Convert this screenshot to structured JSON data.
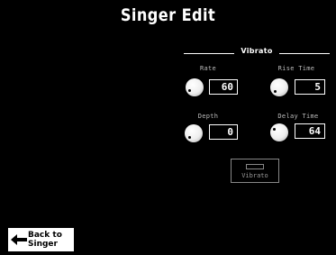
{
  "screen": {
    "title": "Singer Edit"
  },
  "vibrato": {
    "group_title": "Vibrato",
    "rate": {
      "label": "Rate",
      "value": "60"
    },
    "rise_time": {
      "label": "Rise Time",
      "value": "5"
    },
    "depth": {
      "label": "Depth",
      "value": "0"
    },
    "delay_time": {
      "label": "Delay Time",
      "value": "64"
    },
    "toggle_label": "Vibrato"
  },
  "footer": {
    "back_label_line1": "Back to",
    "back_label_line2": "Singer"
  },
  "colors": {
    "background": "#000000",
    "foreground": "#ffffff"
  },
  "icons": {
    "knob": "rotary-knob-icon",
    "back": "left-arrow-icon"
  }
}
